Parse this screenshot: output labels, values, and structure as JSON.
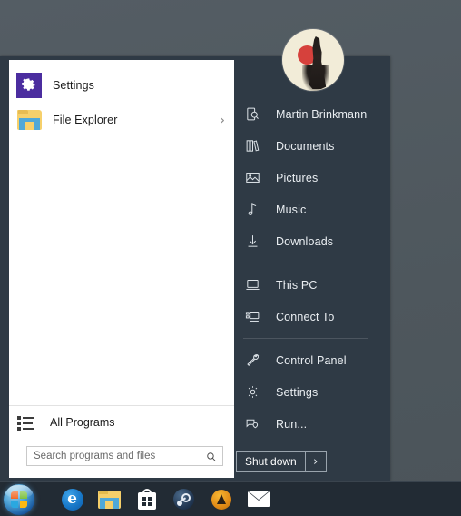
{
  "desktop": {
    "background_color": "#515a60"
  },
  "start_menu": {
    "panel_color": "#2f3a45",
    "left_panel_color": "#ffffff",
    "avatar": {
      "name": "user-avatar",
      "alt": "Martin Brinkmann profile picture"
    },
    "pinned_items": [
      {
        "label": "Settings",
        "icon": "settings-gear-icon",
        "has_submenu": false
      },
      {
        "label": "File Explorer",
        "icon": "folder-icon",
        "has_submenu": true,
        "arrow": "›"
      }
    ],
    "all_programs": {
      "label": "All Programs",
      "icon": "program-list-icon"
    },
    "search": {
      "placeholder": "Search programs and files",
      "value": "",
      "icon": "search-icon"
    },
    "right_items": [
      {
        "label": "Martin Brinkmann",
        "icon": "user-icon",
        "separator_after": false
      },
      {
        "label": "Documents",
        "icon": "documents-icon",
        "separator_after": false
      },
      {
        "label": "Pictures",
        "icon": "pictures-icon",
        "separator_after": false
      },
      {
        "label": "Music",
        "icon": "music-note-icon",
        "separator_after": false
      },
      {
        "label": "Downloads",
        "icon": "download-arrow-icon",
        "separator_after": true
      },
      {
        "label": "This PC",
        "icon": "computer-icon",
        "separator_after": false
      },
      {
        "label": "Connect To",
        "icon": "connect-to-icon",
        "separator_after": true
      },
      {
        "label": "Control Panel",
        "icon": "control-panel-icon",
        "separator_after": false
      },
      {
        "label": "Settings",
        "icon": "settings-gear-outline-icon",
        "separator_after": false
      },
      {
        "label": "Run...",
        "icon": "run-icon",
        "separator_after": false
      }
    ],
    "shutdown": {
      "label": "Shut down",
      "more_arrow": "›"
    }
  },
  "taskbar": {
    "background_color": "#222b34",
    "start_button": {
      "name": "start-orb",
      "tooltip": "Start"
    },
    "items": [
      {
        "name": "taskbar-edge",
        "label": "Microsoft Edge",
        "glyph": "e"
      },
      {
        "name": "taskbar-file-explorer",
        "label": "File Explorer"
      },
      {
        "name": "taskbar-store",
        "label": "Microsoft Store"
      },
      {
        "name": "taskbar-steam",
        "label": "Steam"
      },
      {
        "name": "taskbar-vlc",
        "label": "VLC Media Player"
      },
      {
        "name": "taskbar-mail",
        "label": "Mail"
      }
    ]
  }
}
